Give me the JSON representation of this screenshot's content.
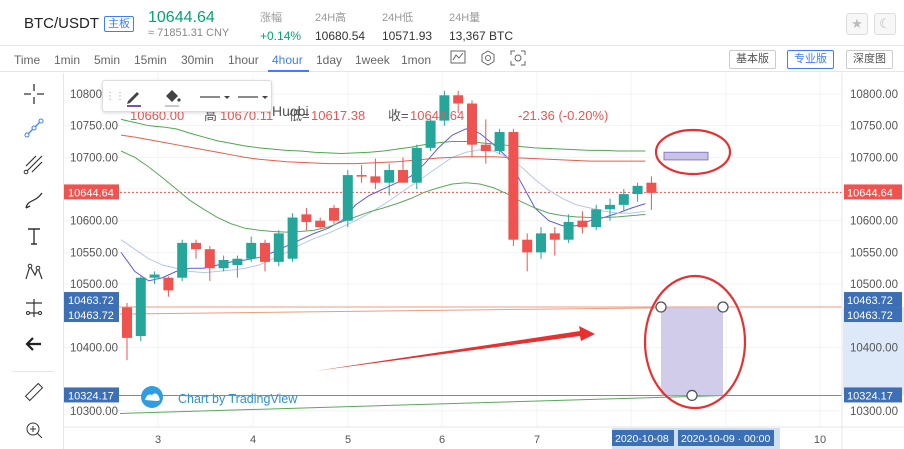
{
  "header": {
    "pair": "BTC/USDT",
    "tag": "主板",
    "price": "10644.64",
    "cny": "≈ 71851.31 CNY",
    "stats": [
      {
        "label": "涨幅",
        "value": "+0.14%"
      },
      {
        "label": "24H高",
        "value": "10680.54"
      },
      {
        "label": "24H低",
        "value": "10571.93"
      },
      {
        "label": "24H量",
        "value": "13,367 BTC"
      }
    ]
  },
  "toolbar": {
    "timeframes": [
      "Time",
      "1min",
      "5min",
      "15min",
      "30min",
      "1hour",
      "4hour",
      "1day",
      "1week",
      "1mon"
    ],
    "active": "4hour",
    "view_buttons": [
      "基本版",
      "专业版",
      "深度图"
    ],
    "active_view": "专业版"
  },
  "legend": {
    "source": "Huobi",
    "open": "10660.00",
    "high_label": "高",
    "high": "10670.11",
    "low_label": "低=",
    "low": "10617.38",
    "close_label": "收=",
    "close": "10644.64",
    "change": "-21.36 (-0.20%)"
  },
  "watermark": "Chart by TradingView",
  "colors": {
    "up": "#26a69a",
    "down": "#ef5350",
    "accent": "#3d7eff",
    "annotation": "#e83030",
    "rect_fill": "#c9c3e6"
  },
  "chart_data": {
    "type": "candlestick",
    "y_axis_labels": [
      "10800.00",
      "10750.00",
      "10700.00",
      "10650.00",
      "10600.00",
      "10550.00",
      "10500.00",
      "10400.00",
      "10300.00"
    ],
    "x_axis_labels": [
      "3",
      "4",
      "5",
      "6",
      "7",
      "8",
      "9",
      "10"
    ],
    "x_cursor_labels": [
      "2020-10-08",
      "2020-10-09 · 00:00"
    ],
    "price_badges": [
      "10644.64",
      "10463.72",
      "10463.72",
      "10324.17"
    ],
    "ylim": [
      10270,
      10815
    ],
    "candles": [
      [
        10463,
        10470,
        10380,
        10415
      ],
      [
        10418,
        10512,
        10410,
        10510
      ],
      [
        10510,
        10520,
        10500,
        10515
      ],
      [
        10510,
        10512,
        10480,
        10490
      ],
      [
        10510,
        10570,
        10505,
        10565
      ],
      [
        10565,
        10570,
        10540,
        10555
      ],
      [
        10555,
        10560,
        10505,
        10525
      ],
      [
        10525,
        10545,
        10520,
        10538
      ],
      [
        10530,
        10545,
        10510,
        10540
      ],
      [
        10540,
        10575,
        10535,
        10565
      ],
      [
        10565,
        10570,
        10520,
        10535
      ],
      [
        10535,
        10585,
        10528,
        10580
      ],
      [
        10540,
        10612,
        10535,
        10605
      ],
      [
        10610,
        10620,
        10585,
        10598
      ],
      [
        10600,
        10605,
        10588,
        10590
      ],
      [
        10620,
        10625,
        10595,
        10600
      ],
      [
        10600,
        10680,
        10590,
        10672
      ],
      [
        10672,
        10688,
        10660,
        10670
      ],
      [
        10670,
        10698,
        10650,
        10660
      ],
      [
        10660,
        10690,
        10640,
        10680
      ],
      [
        10680,
        10700,
        10660,
        10660
      ],
      [
        10660,
        10720,
        10650,
        10715
      ],
      [
        10715,
        10760,
        10710,
        10758
      ],
      [
        10758,
        10805,
        10750,
        10798
      ],
      [
        10798,
        10805,
        10770,
        10785
      ],
      [
        10785,
        10790,
        10700,
        10720
      ],
      [
        10720,
        10760,
        10690,
        10710
      ],
      [
        10710,
        10745,
        10705,
        10740
      ],
      [
        10740,
        10745,
        10560,
        10570
      ],
      [
        10570,
        10580,
        10520,
        10550
      ],
      [
        10550,
        10590,
        10540,
        10580
      ],
      [
        10580,
        10590,
        10545,
        10570
      ],
      [
        10570,
        10610,
        10565,
        10598
      ],
      [
        10600,
        10615,
        10580,
        10590
      ],
      [
        10590,
        10625,
        10585,
        10618
      ],
      [
        10618,
        10635,
        10600,
        10625
      ],
      [
        10625,
        10650,
        10615,
        10642
      ],
      [
        10642,
        10660,
        10630,
        10655
      ],
      [
        10660,
        10670,
        10617,
        10644
      ]
    ],
    "ma_lines": [
      {
        "color": "#5b5be0",
        "values": [
          10550,
          10520,
          10505,
          10510,
          10520,
          10525,
          10525,
          10530,
          10535,
          10538,
          10542,
          10550,
          10560,
          10570,
          10580,
          10588,
          10600,
          10625,
          10640,
          10650,
          10660,
          10670,
          10690,
          10715,
          10735,
          10745,
          10738,
          10720,
          10700,
          10660,
          10620,
          10600,
          10592,
          10592,
          10600,
          10605,
          10612,
          10620,
          10627
        ]
      },
      {
        "color": "#b4c7e8",
        "values": [
          10570,
          10555,
          10540,
          10530,
          10525,
          10520,
          10518,
          10520,
          10522,
          10525,
          10530,
          10540,
          10550,
          10562,
          10572,
          10580,
          10590,
          10600,
          10612,
          10625,
          10640,
          10655,
          10670,
          10685,
          10700,
          10708,
          10712,
          10710,
          10700,
          10685,
          10665,
          10648,
          10635,
          10625,
          10620,
          10615,
          10612,
          10612,
          10615
        ]
      },
      {
        "color": "#4ca94c",
        "values": [
          10760,
          10755,
          10750,
          10748,
          10745,
          10738,
          10732,
          10726,
          10722,
          10718,
          10715,
          10713,
          10711,
          10710,
          10708,
          10707,
          10706,
          10707,
          10708,
          10710,
          10713,
          10716,
          10720,
          10723,
          10725,
          10725,
          10723,
          10721,
          10719,
          10717,
          10715,
          10714,
          10713,
          10712,
          10711,
          10711,
          10710,
          10710,
          10710
        ]
      },
      {
        "color": "#e85d4a",
        "values": [
          10735,
          10732,
          10728,
          10724,
          10720,
          10716,
          10712,
          10708,
          10704,
          10700,
          10697,
          10695,
          10693,
          10692,
          10691,
          10690,
          10690,
          10690,
          10691,
          10692,
          10693,
          10695,
          10697,
          10699,
          10700,
          10701,
          10701,
          10701,
          10700,
          10699,
          10698,
          10697,
          10696,
          10695,
          10694,
          10694,
          10694,
          10694,
          10694
        ]
      },
      {
        "color": "#5aa85a",
        "values": [
          10710,
          10700,
          10685,
          10668,
          10650,
          10632,
          10618,
          10605,
          10595,
          10588,
          10585,
          10583,
          10582,
          10583,
          10585,
          10590,
          10598,
          10606,
          10614,
          10620,
          10627,
          10635,
          10645,
          10652,
          10658,
          10660,
          10658,
          10652,
          10642,
          10630,
          10620,
          10612,
          10608,
          10606,
          10605,
          10605,
          10606,
          10608,
          10610
        ]
      }
    ],
    "horizontal_lines": [
      {
        "value": 10644.64,
        "color": "#ef5350",
        "dashed": true
      },
      {
        "value": 10463.72,
        "color": "#f29a7c",
        "dashed": false
      },
      {
        "value": 10324.17,
        "color": "#5aa85a",
        "dashed": false
      }
    ],
    "rectangles": [
      {
        "top": 10463.72,
        "bottom": 10324.17,
        "shape": "large"
      },
      {
        "top": 10708,
        "bottom": 10696,
        "shape": "small"
      }
    ]
  }
}
